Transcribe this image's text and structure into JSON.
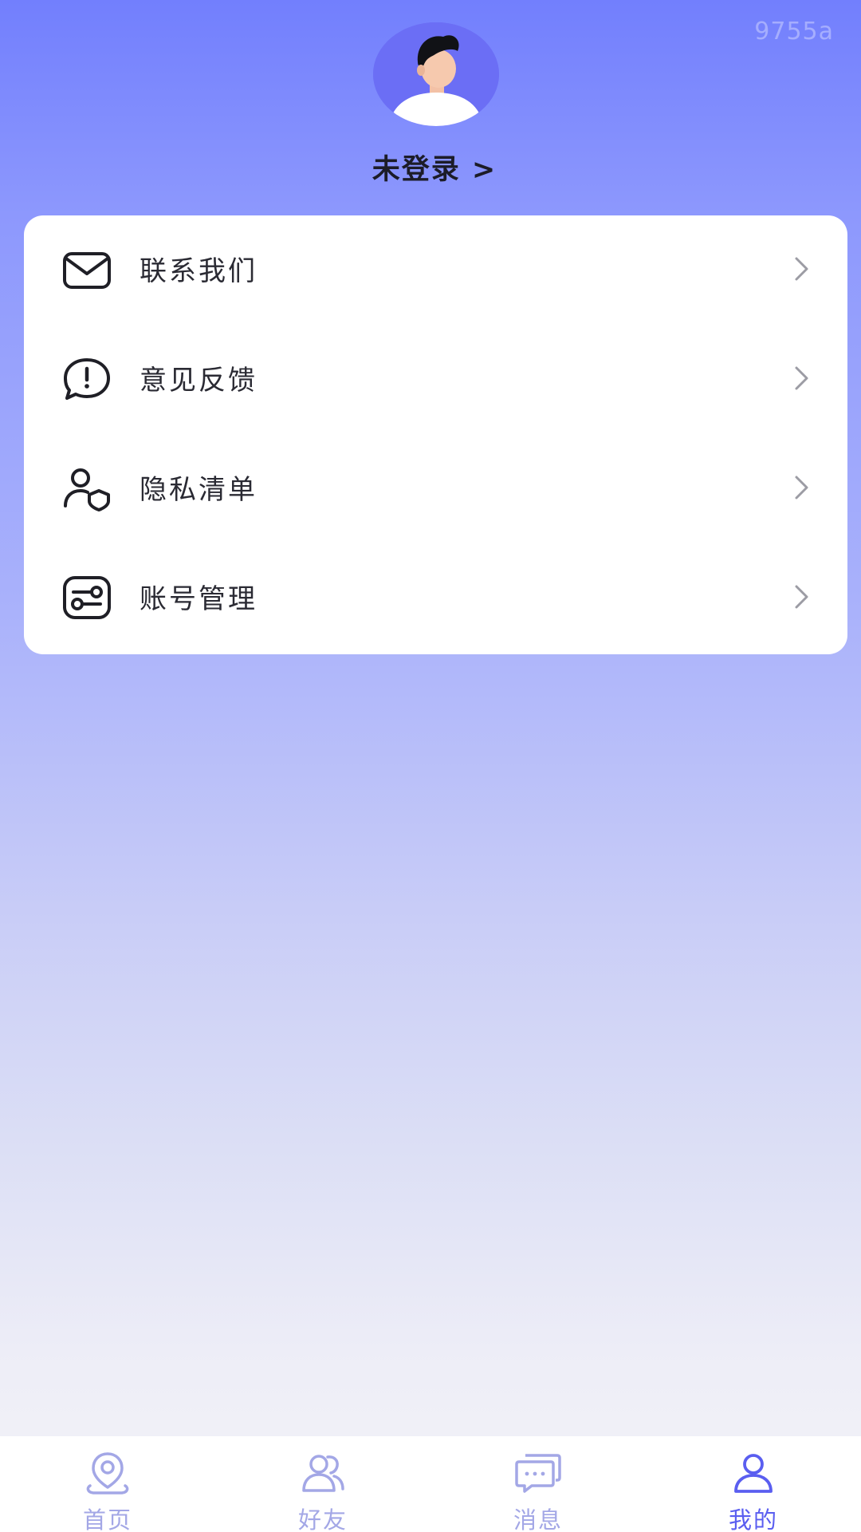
{
  "header": {
    "version_tag": "9755a",
    "login_label": "未登录 >"
  },
  "menu": {
    "items": [
      {
        "label": "联系我们",
        "icon": "mail-icon"
      },
      {
        "label": "意见反馈",
        "icon": "feedback-icon"
      },
      {
        "label": "隐私清单",
        "icon": "privacy-icon"
      },
      {
        "label": "账号管理",
        "icon": "account-settings-icon"
      }
    ]
  },
  "tabs": [
    {
      "label": "首页",
      "icon": "home-location-icon",
      "active": false
    },
    {
      "label": "好友",
      "icon": "friends-icon",
      "active": false
    },
    {
      "label": "消息",
      "icon": "message-icon",
      "active": false
    },
    {
      "label": "我的",
      "icon": "profile-icon",
      "active": true
    }
  ],
  "colors": {
    "accent": "#5a5ef0",
    "tab_inactive": "#a3a7e6",
    "gradient_top": "#727ffd",
    "gradient_bottom": "#f4f4f7"
  }
}
